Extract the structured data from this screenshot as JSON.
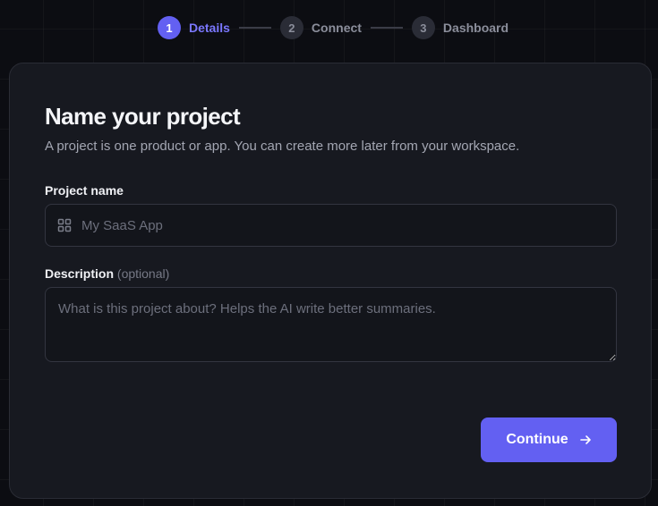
{
  "stepper": {
    "steps": [
      {
        "number": "1",
        "label": "Details",
        "state": "active"
      },
      {
        "number": "2",
        "label": "Connect",
        "state": "upcoming"
      },
      {
        "number": "3",
        "label": "Dashboard",
        "state": "upcoming"
      }
    ]
  },
  "form": {
    "title": "Name your project",
    "subtitle": "A project is one product or app. You can create more later from your workspace.",
    "project_name": {
      "label": "Project name",
      "placeholder": "My SaaS App",
      "value": "",
      "icon": "grid-icon"
    },
    "description": {
      "label": "Description",
      "optional_label": "(optional)",
      "placeholder": "What is this project about? Helps the AI write better summaries.",
      "value": ""
    },
    "continue_button": {
      "label": "Continue",
      "icon": "arrow-right-icon"
    }
  },
  "colors": {
    "accent": "#6360f2",
    "accent_text": "#7a77ff",
    "card_background": "#171920",
    "page_background": "#0c0d12"
  }
}
